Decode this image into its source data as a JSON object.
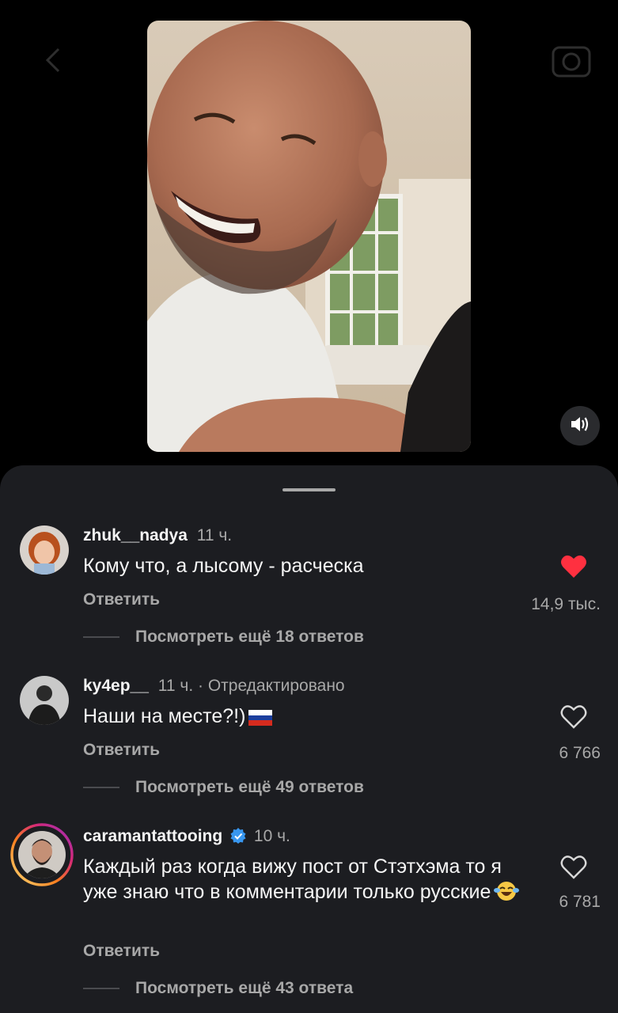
{
  "icons": {
    "back": "chevron-left-icon",
    "camera": "camera-icon",
    "sound": "speaker-icon",
    "like_filled": "heart-filled-icon",
    "like_outline": "heart-outline-icon",
    "verified": "verified-badge-icon",
    "flag": "russian-flag-emoji",
    "laugh": "laughing-emoji"
  },
  "colors": {
    "background": "#000000",
    "sheet": "#1c1d21",
    "text_primary": "#f5f5f5",
    "text_secondary": "#a8a8a8",
    "like_red": "#ff3040",
    "verified_blue": "#3897f0"
  },
  "comments": [
    {
      "username": "zhuk__nadya",
      "time": "11 ч.",
      "text": "Кому что, а лысому - расческа",
      "reply_label": "Ответить",
      "likes": "14,9 тыс.",
      "liked": true,
      "view_more": "Посмотреть ещё 18 ответов"
    },
    {
      "username": "ky4ep__",
      "time": "11 ч. · Отредактировано",
      "text": "Наши на месте?!)",
      "reply_label": "Ответить",
      "likes": "6 766",
      "liked": false,
      "view_more": "Посмотреть ещё 49 ответов"
    },
    {
      "username": "caramantattooing",
      "verified": true,
      "time": "10 ч.",
      "text": "Каждый раз когда вижу пост от Стэтхэма то я уже знаю что в комментарии только русские",
      "reply_label": "Ответить",
      "likes": "6 781",
      "liked": false,
      "view_more": "Посмотреть ещё 43 ответа"
    }
  ]
}
